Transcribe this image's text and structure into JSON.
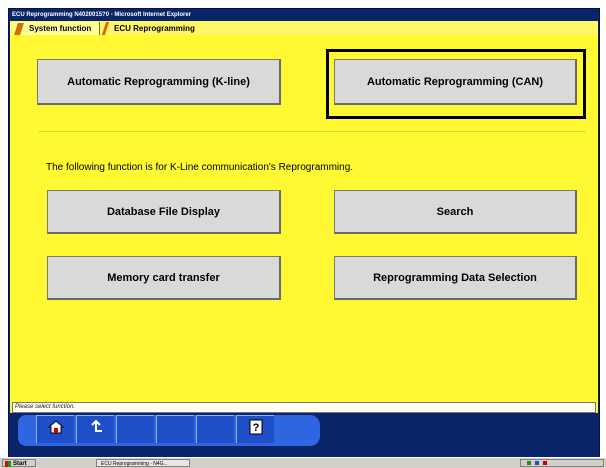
{
  "window": {
    "title": "ECU Reprogramming  N4020015?0 - Microsoft Internet Explorer"
  },
  "tabs": [
    {
      "label": "System function"
    },
    {
      "label": "ECU Reprogramming"
    }
  ],
  "buttons": {
    "auto_kline": "Automatic Reprogramming (K-line)",
    "auto_can": "Automatic Reprogramming (CAN)",
    "database_file_display": "Database File Display",
    "search": "Search",
    "memory_card_transfer": "Memory card transfer",
    "reprogramming_data_selection": "Reprogramming Data Selection"
  },
  "info_text": "The following function is for K-Line communication's Reprogramming.",
  "status_text": "Please select function.",
  "toolbar": {
    "icons": [
      "home-icon",
      "back-arrow-icon",
      "help-icon"
    ]
  },
  "taskbar": {
    "start_label": "Start",
    "task_item": "ECU Reprogramming - N4G..."
  },
  "colors": {
    "background": "#fff833",
    "highlight_border": "#000000",
    "toolbar": "#2e65e0"
  }
}
